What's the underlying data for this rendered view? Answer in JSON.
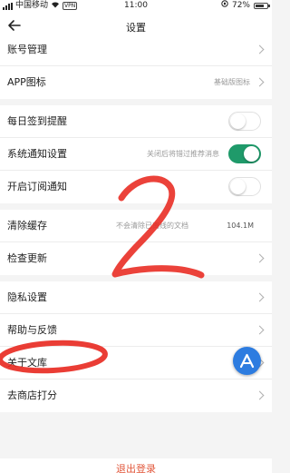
{
  "status_bar": {
    "carrier": "中国移动",
    "vpn": "VPN",
    "time": "11:00",
    "battery": "72%",
    "battery_level": 0.72
  },
  "nav": {
    "title": "设置"
  },
  "rows": {
    "account": {
      "label": "账号管理"
    },
    "app_icon": {
      "label": "APP图标",
      "value": "基础版图标"
    },
    "daily_checkin": {
      "label": "每日签到提醒",
      "on": false
    },
    "system_notify": {
      "label": "系统通知设置",
      "value": "关闭后将错过推荐消息",
      "on": true
    },
    "subscription_notify": {
      "label": "开启订阅通知",
      "on": false
    },
    "clear_cache": {
      "label": "清除缓存",
      "hint": "不会清除已离线的文档",
      "value": "104.1M"
    },
    "check_update": {
      "label": "检查更新"
    },
    "privacy": {
      "label": "隐私设置"
    },
    "help_feedback": {
      "label": "帮助与反馈"
    },
    "about": {
      "label": "关于文库"
    },
    "rate": {
      "label": "去商店打分"
    }
  },
  "logout": {
    "label": "退出登录"
  },
  "annotation": {
    "digit": "2"
  },
  "colors": {
    "accent_green": "#1f9a6a",
    "logout_red": "#e2583c",
    "annotation_red": "#e8281f",
    "fab_blue": "#2d7ce0"
  }
}
